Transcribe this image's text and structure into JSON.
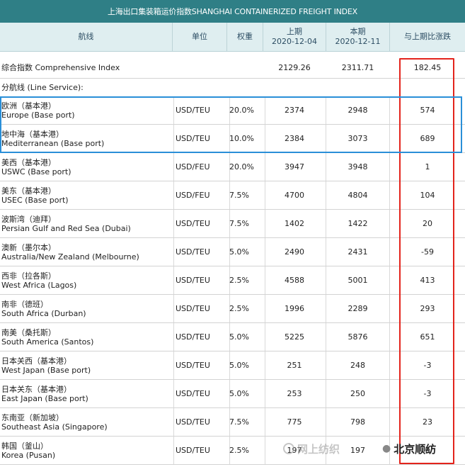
{
  "title": "上海出口集装箱运价指数SHANGHAI CONTAINERIZED FREIGHT INDEX",
  "headers": {
    "route": "航线",
    "unit": "单位",
    "weight": "权重",
    "prev_label": "上期",
    "prev_date": "2020-12-04",
    "curr_label": "本期",
    "curr_date": "2020-12-11",
    "change": "与上期比涨跌"
  },
  "composite": {
    "name": "综合指数 Comprehensive Index",
    "prev": "2129.26",
    "curr": "2311.71",
    "change": "182.45"
  },
  "section_label": "分航线 (Line Service):",
  "rows": [
    {
      "cn": "欧洲（基本港）",
      "en": "Europe (Base port)",
      "unit": "USD/TEU",
      "weight": "20.0%",
      "prev": "2374",
      "curr": "2948",
      "change": "574"
    },
    {
      "cn": "地中海（基本港）",
      "en": "Mediterranean (Base port)",
      "unit": "USD/TEU",
      "weight": "10.0%",
      "prev": "2384",
      "curr": "3073",
      "change": "689"
    },
    {
      "cn": "美西（基本港）",
      "en": "USWC (Base port)",
      "unit": "USD/FEU",
      "weight": "20.0%",
      "prev": "3947",
      "curr": "3948",
      "change": "1"
    },
    {
      "cn": "美东（基本港）",
      "en": "USEC (Base port)",
      "unit": "USD/FEU",
      "weight": "7.5%",
      "prev": "4700",
      "curr": "4804",
      "change": "104"
    },
    {
      "cn": "波斯湾（迪拜）",
      "en": "Persian Gulf and Red Sea (Dubai)",
      "unit": "USD/TEU",
      "weight": "7.5%",
      "prev": "1402",
      "curr": "1422",
      "change": "20"
    },
    {
      "cn": "澳新（墨尔本）",
      "en": "Australia/New Zealand (Melbourne)",
      "unit": "USD/TEU",
      "weight": "5.0%",
      "prev": "2490",
      "curr": "2431",
      "change": "-59"
    },
    {
      "cn": "西非（拉各斯）",
      "en": "West Africa (Lagos)",
      "unit": "USD/TEU",
      "weight": "2.5%",
      "prev": "4588",
      "curr": "5001",
      "change": "413"
    },
    {
      "cn": "南非（德班）",
      "en": "South Africa (Durban)",
      "unit": "USD/TEU",
      "weight": "2.5%",
      "prev": "1996",
      "curr": "2289",
      "change": "293"
    },
    {
      "cn": "南美（桑托斯）",
      "en": "South America (Santos)",
      "unit": "USD/TEU",
      "weight": "5.0%",
      "prev": "5225",
      "curr": "5876",
      "change": "651"
    },
    {
      "cn": "日本关西（基本港）",
      "en": "West Japan (Base port)",
      "unit": "USD/TEU",
      "weight": "5.0%",
      "prev": "251",
      "curr": "248",
      "change": "-3"
    },
    {
      "cn": "日本关东（基本港）",
      "en": "East Japan (Base port)",
      "unit": "USD/TEU",
      "weight": "5.0%",
      "prev": "253",
      "curr": "250",
      "change": "-3"
    },
    {
      "cn": "东南亚（新加坡）",
      "en": "Southeast Asia (Singapore)",
      "unit": "USD/TEU",
      "weight": "7.5%",
      "prev": "775",
      "curr": "798",
      "change": "23"
    },
    {
      "cn": "韩国（釜山）",
      "en": "Korea (Pusan)",
      "unit": "USD/TEU",
      "weight": "2.5%",
      "prev": "197",
      "curr": "197",
      "change": "0"
    }
  ],
  "watermark": {
    "left": "网上纺织",
    "right": "北京顺纺"
  }
}
